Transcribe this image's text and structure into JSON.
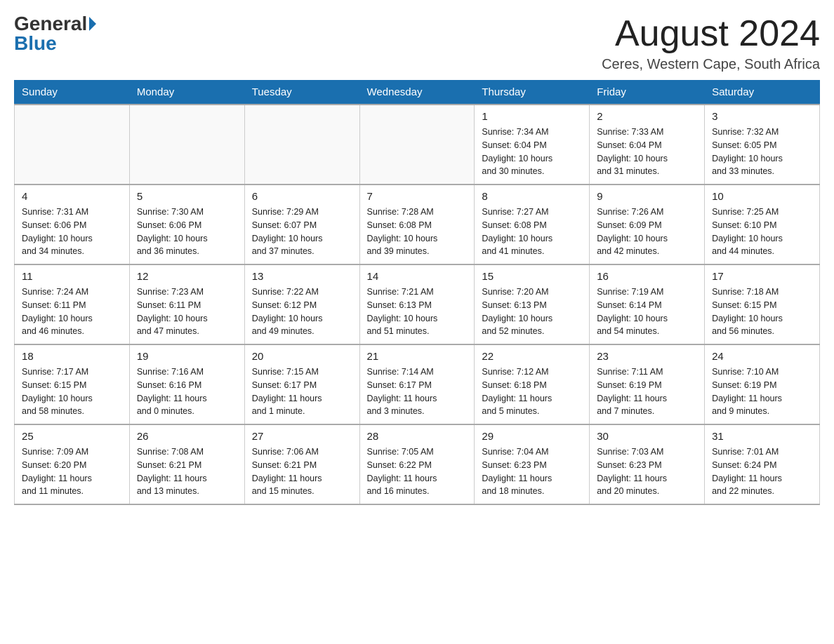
{
  "logo": {
    "general": "General",
    "blue": "Blue"
  },
  "title": "August 2024",
  "location": "Ceres, Western Cape, South Africa",
  "days_of_week": [
    "Sunday",
    "Monday",
    "Tuesday",
    "Wednesday",
    "Thursday",
    "Friday",
    "Saturday"
  ],
  "weeks": [
    [
      {
        "day": "",
        "info": ""
      },
      {
        "day": "",
        "info": ""
      },
      {
        "day": "",
        "info": ""
      },
      {
        "day": "",
        "info": ""
      },
      {
        "day": "1",
        "info": "Sunrise: 7:34 AM\nSunset: 6:04 PM\nDaylight: 10 hours\nand 30 minutes."
      },
      {
        "day": "2",
        "info": "Sunrise: 7:33 AM\nSunset: 6:04 PM\nDaylight: 10 hours\nand 31 minutes."
      },
      {
        "day": "3",
        "info": "Sunrise: 7:32 AM\nSunset: 6:05 PM\nDaylight: 10 hours\nand 33 minutes."
      }
    ],
    [
      {
        "day": "4",
        "info": "Sunrise: 7:31 AM\nSunset: 6:06 PM\nDaylight: 10 hours\nand 34 minutes."
      },
      {
        "day": "5",
        "info": "Sunrise: 7:30 AM\nSunset: 6:06 PM\nDaylight: 10 hours\nand 36 minutes."
      },
      {
        "day": "6",
        "info": "Sunrise: 7:29 AM\nSunset: 6:07 PM\nDaylight: 10 hours\nand 37 minutes."
      },
      {
        "day": "7",
        "info": "Sunrise: 7:28 AM\nSunset: 6:08 PM\nDaylight: 10 hours\nand 39 minutes."
      },
      {
        "day": "8",
        "info": "Sunrise: 7:27 AM\nSunset: 6:08 PM\nDaylight: 10 hours\nand 41 minutes."
      },
      {
        "day": "9",
        "info": "Sunrise: 7:26 AM\nSunset: 6:09 PM\nDaylight: 10 hours\nand 42 minutes."
      },
      {
        "day": "10",
        "info": "Sunrise: 7:25 AM\nSunset: 6:10 PM\nDaylight: 10 hours\nand 44 minutes."
      }
    ],
    [
      {
        "day": "11",
        "info": "Sunrise: 7:24 AM\nSunset: 6:11 PM\nDaylight: 10 hours\nand 46 minutes."
      },
      {
        "day": "12",
        "info": "Sunrise: 7:23 AM\nSunset: 6:11 PM\nDaylight: 10 hours\nand 47 minutes."
      },
      {
        "day": "13",
        "info": "Sunrise: 7:22 AM\nSunset: 6:12 PM\nDaylight: 10 hours\nand 49 minutes."
      },
      {
        "day": "14",
        "info": "Sunrise: 7:21 AM\nSunset: 6:13 PM\nDaylight: 10 hours\nand 51 minutes."
      },
      {
        "day": "15",
        "info": "Sunrise: 7:20 AM\nSunset: 6:13 PM\nDaylight: 10 hours\nand 52 minutes."
      },
      {
        "day": "16",
        "info": "Sunrise: 7:19 AM\nSunset: 6:14 PM\nDaylight: 10 hours\nand 54 minutes."
      },
      {
        "day": "17",
        "info": "Sunrise: 7:18 AM\nSunset: 6:15 PM\nDaylight: 10 hours\nand 56 minutes."
      }
    ],
    [
      {
        "day": "18",
        "info": "Sunrise: 7:17 AM\nSunset: 6:15 PM\nDaylight: 10 hours\nand 58 minutes."
      },
      {
        "day": "19",
        "info": "Sunrise: 7:16 AM\nSunset: 6:16 PM\nDaylight: 11 hours\nand 0 minutes."
      },
      {
        "day": "20",
        "info": "Sunrise: 7:15 AM\nSunset: 6:17 PM\nDaylight: 11 hours\nand 1 minute."
      },
      {
        "day": "21",
        "info": "Sunrise: 7:14 AM\nSunset: 6:17 PM\nDaylight: 11 hours\nand 3 minutes."
      },
      {
        "day": "22",
        "info": "Sunrise: 7:12 AM\nSunset: 6:18 PM\nDaylight: 11 hours\nand 5 minutes."
      },
      {
        "day": "23",
        "info": "Sunrise: 7:11 AM\nSunset: 6:19 PM\nDaylight: 11 hours\nand 7 minutes."
      },
      {
        "day": "24",
        "info": "Sunrise: 7:10 AM\nSunset: 6:19 PM\nDaylight: 11 hours\nand 9 minutes."
      }
    ],
    [
      {
        "day": "25",
        "info": "Sunrise: 7:09 AM\nSunset: 6:20 PM\nDaylight: 11 hours\nand 11 minutes."
      },
      {
        "day": "26",
        "info": "Sunrise: 7:08 AM\nSunset: 6:21 PM\nDaylight: 11 hours\nand 13 minutes."
      },
      {
        "day": "27",
        "info": "Sunrise: 7:06 AM\nSunset: 6:21 PM\nDaylight: 11 hours\nand 15 minutes."
      },
      {
        "day": "28",
        "info": "Sunrise: 7:05 AM\nSunset: 6:22 PM\nDaylight: 11 hours\nand 16 minutes."
      },
      {
        "day": "29",
        "info": "Sunrise: 7:04 AM\nSunset: 6:23 PM\nDaylight: 11 hours\nand 18 minutes."
      },
      {
        "day": "30",
        "info": "Sunrise: 7:03 AM\nSunset: 6:23 PM\nDaylight: 11 hours\nand 20 minutes."
      },
      {
        "day": "31",
        "info": "Sunrise: 7:01 AM\nSunset: 6:24 PM\nDaylight: 11 hours\nand 22 minutes."
      }
    ]
  ]
}
